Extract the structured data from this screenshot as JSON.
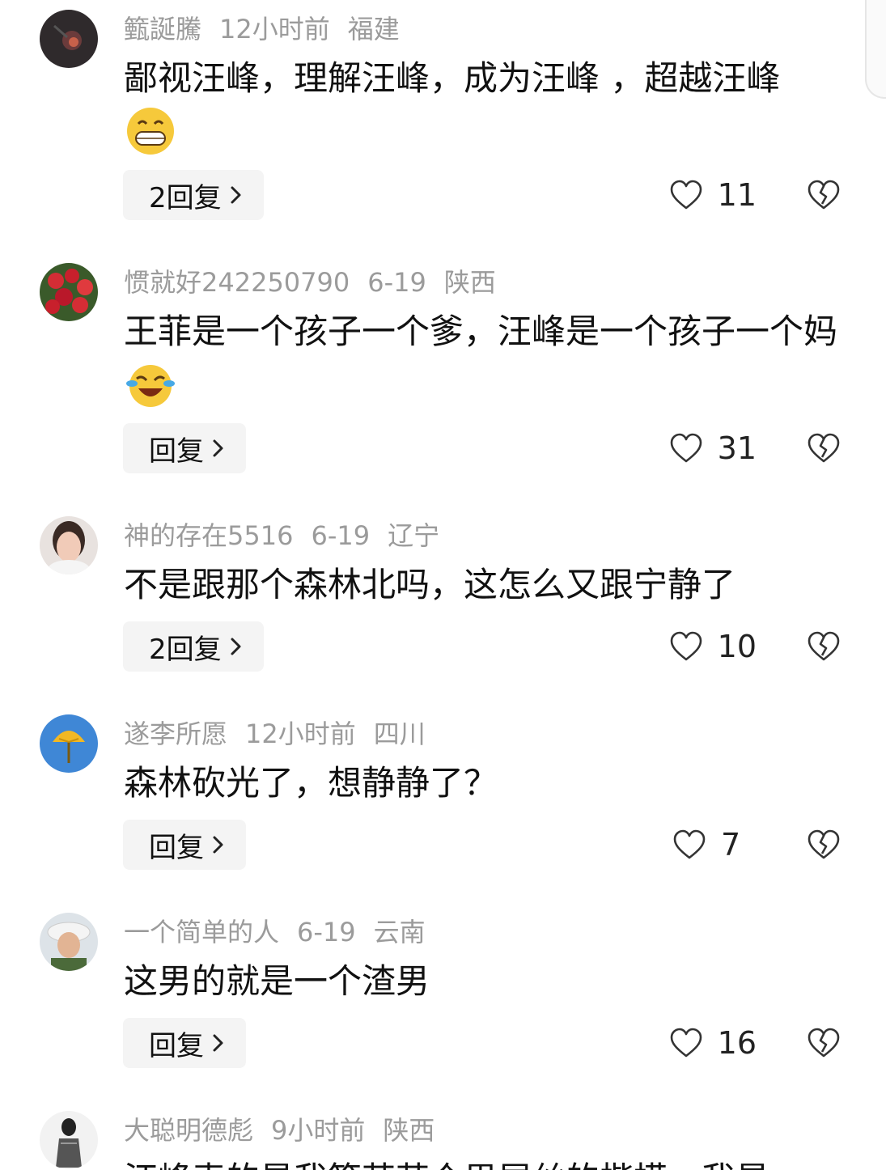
{
  "comments": [
    {
      "username": "籈誕騰",
      "time": "12小时前",
      "location": "福建",
      "text": "鄙视汪峰，理解汪峰，成为汪峰 ，超越汪峰",
      "emoji": "grin-emoji",
      "reply_label": "2回复",
      "likes": "11"
    },
    {
      "username": "惯就好242250790",
      "time": "6-19",
      "location": "陕西",
      "text": "王菲是一个孩子一个爹，汪峰是一个孩子一个妈",
      "emoji": "laugh-cry-emoji",
      "reply_label": "回复",
      "likes": "31"
    },
    {
      "username": "神的存在5516",
      "time": "6-19",
      "location": "辽宁",
      "text": "不是跟那个森林北吗，这怎么又跟宁静了",
      "reply_label": "2回复",
      "likes": "10"
    },
    {
      "username": "遂李所愿",
      "time": "12小时前",
      "location": "四川",
      "text": "森林砍光了，想静静了？",
      "reply_label": "回复",
      "likes": "7"
    },
    {
      "username": "一个简单的人",
      "time": "6-19",
      "location": "云南",
      "text": "这男的就是一个渣男",
      "reply_label": "回复",
      "likes": "16"
    },
    {
      "username": "大聪明德彪",
      "time": "9小时前",
      "location": "陕西",
      "text": "汪峰表的是我等芸芸众男屌丝的楷模，我是"
    }
  ],
  "colors": {
    "meta": "#9b9b9b",
    "text": "#111111",
    "reply_bg": "#f4f4f4",
    "icon": "#333333"
  },
  "icons": {
    "like": "heart-outline-icon",
    "dislike": "broken-heart-icon",
    "chevron": "chevron-right-icon"
  }
}
